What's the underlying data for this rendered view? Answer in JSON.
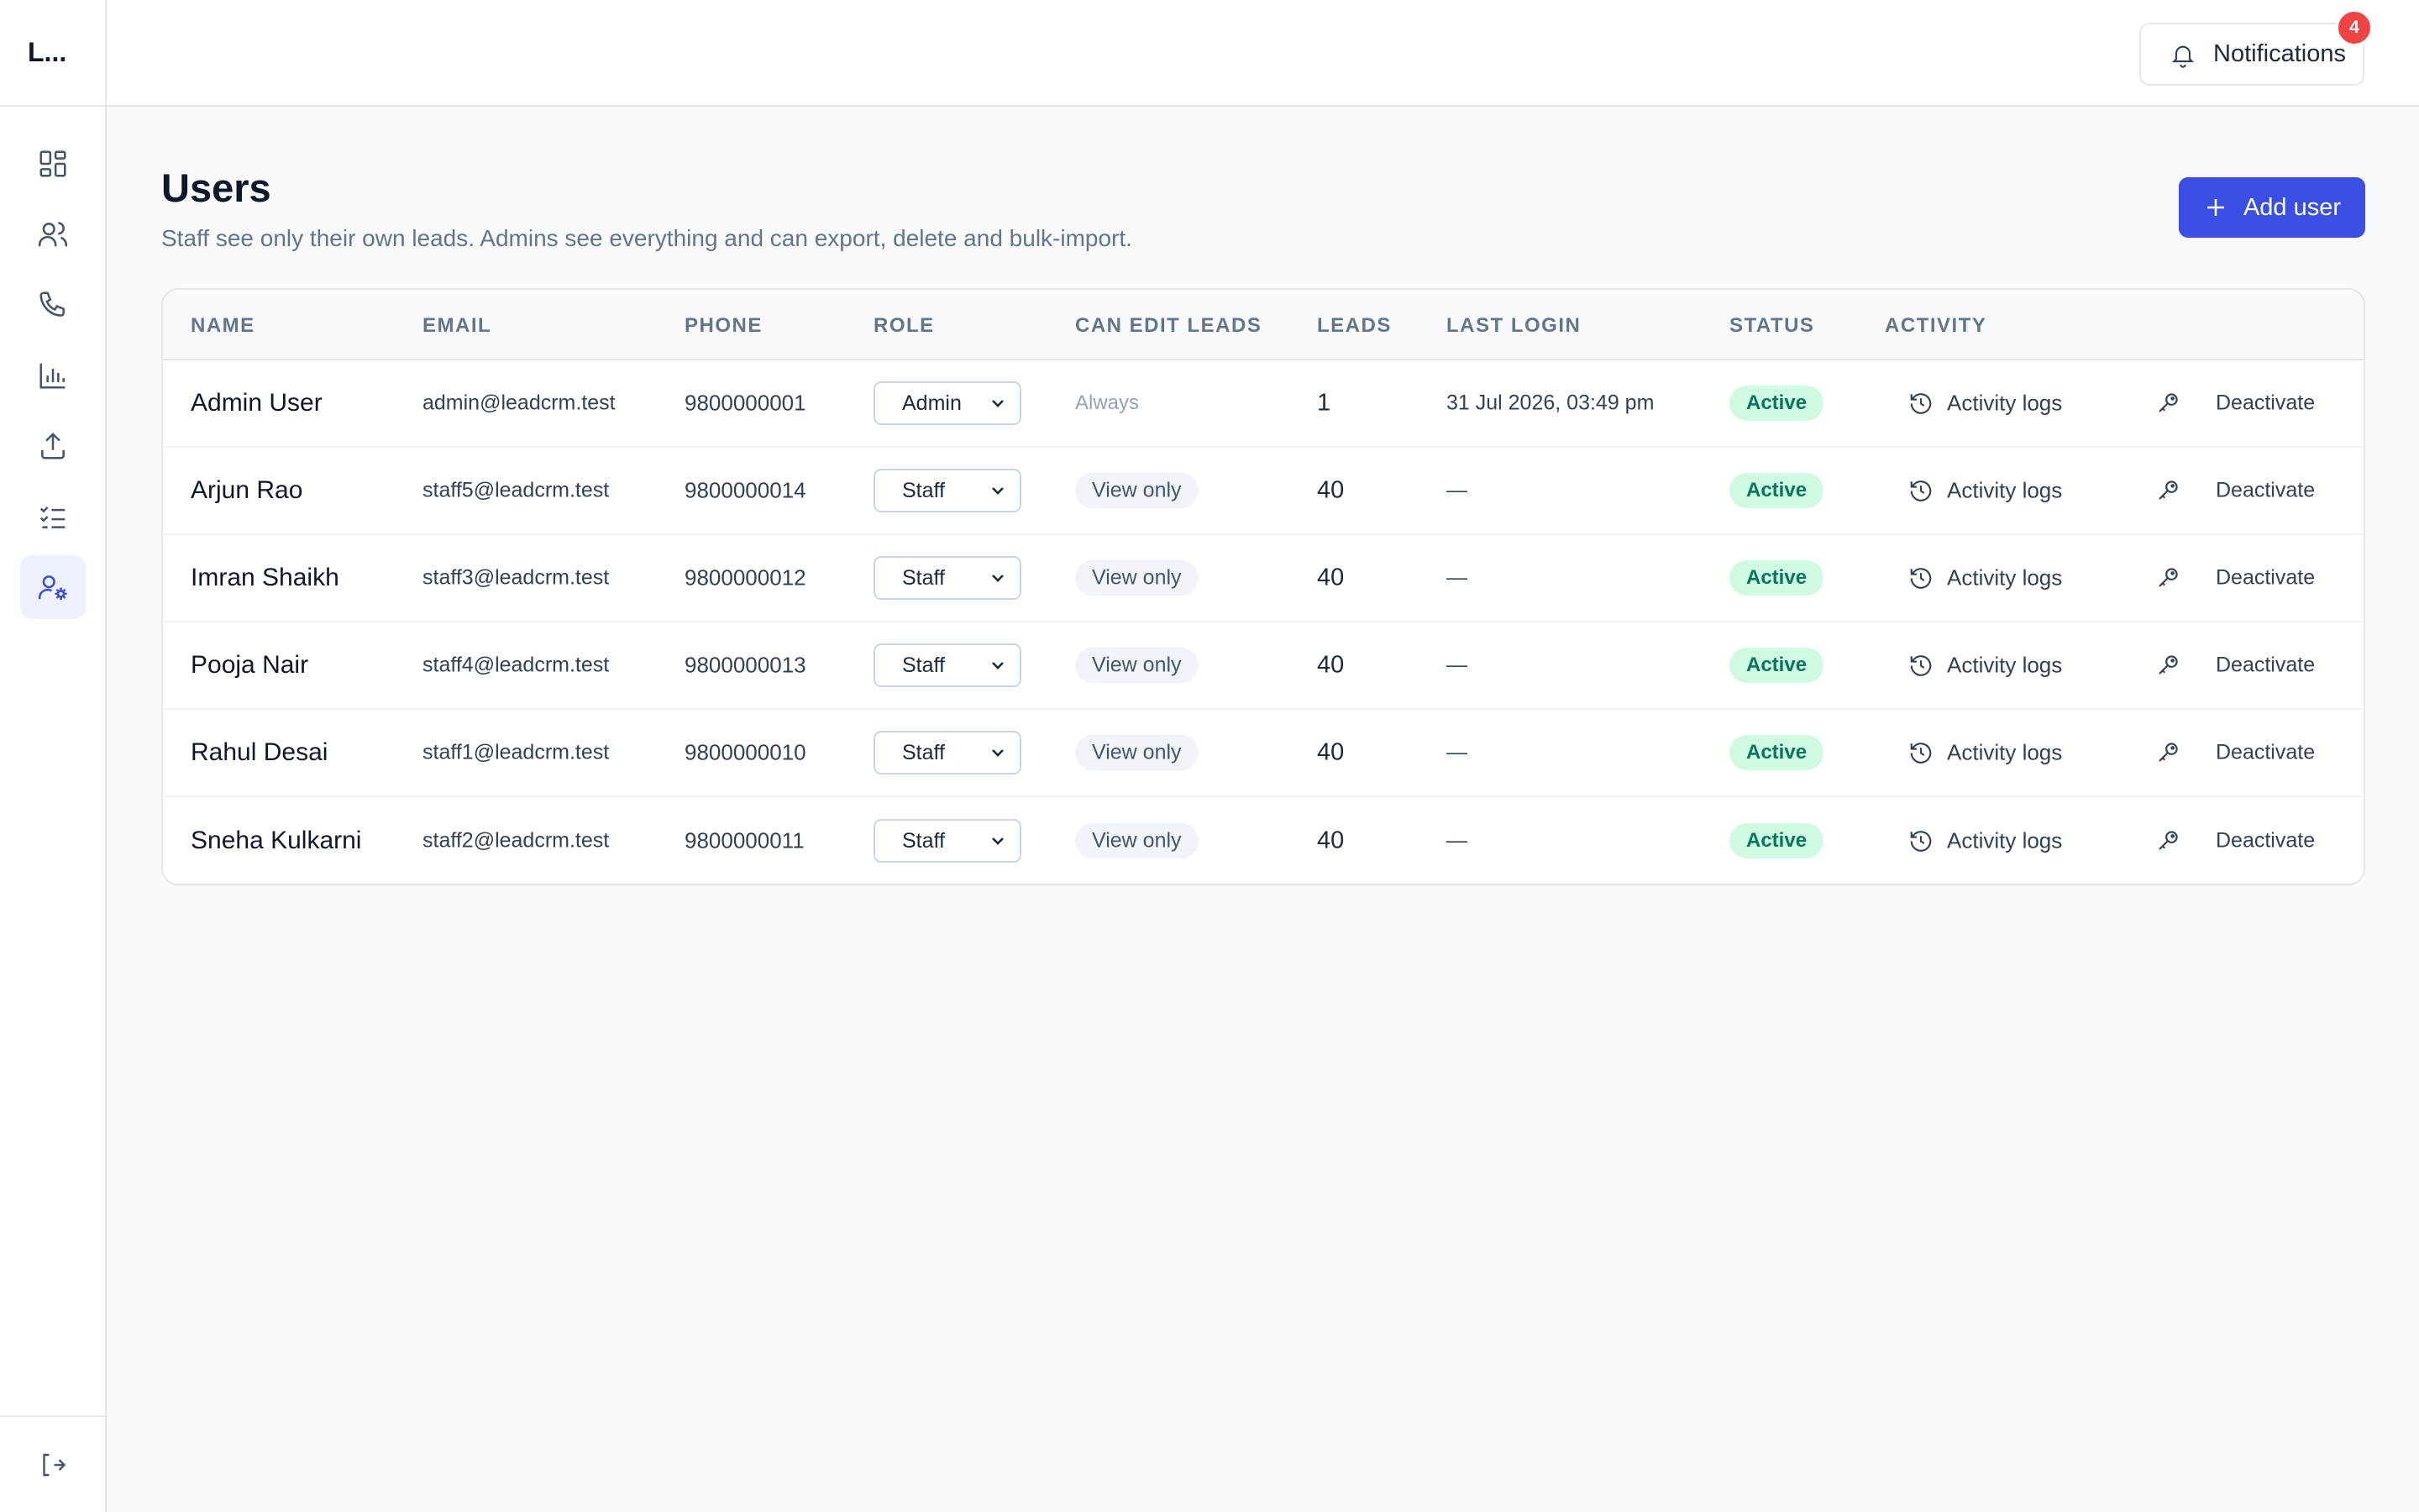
{
  "app": {
    "brand": "L..."
  },
  "sidebar": {
    "items": [
      {
        "icon": "dashboard-icon",
        "active": false
      },
      {
        "icon": "users-icon",
        "active": false
      },
      {
        "icon": "phone-icon",
        "active": false
      },
      {
        "icon": "bar-chart-icon",
        "active": false
      },
      {
        "icon": "upload-icon",
        "active": false
      },
      {
        "icon": "checklist-icon",
        "active": false
      },
      {
        "icon": "user-settings-icon",
        "active": true
      }
    ],
    "logout_icon": "logout-icon"
  },
  "topbar": {
    "notifications_label": "Notifications",
    "notifications_count": "4"
  },
  "header": {
    "title": "Users",
    "subtitle": "Staff see only their own leads. Admins see everything and can export, delete and bulk-import.",
    "add_user_label": "Add user"
  },
  "table": {
    "columns": {
      "name": "NAME",
      "email": "EMAIL",
      "phone": "PHONE",
      "role": "ROLE",
      "can_edit": "CAN EDIT LEADS",
      "leads": "LEADS",
      "last_login": "LAST LOGIN",
      "status": "STATUS",
      "activity": "ACTIVITY"
    },
    "rows": [
      {
        "name": "Admin User",
        "email": "admin@leadcrm.test",
        "phone": "9800000001",
        "role": "Admin",
        "can_edit": "Always",
        "leads": "1",
        "last_login": "31 Jul 2026, 03:49 pm",
        "status": "Active",
        "activity": "Activity logs",
        "action": "Deactivate"
      },
      {
        "name": "Arjun Rao",
        "email": "staff5@leadcrm.test",
        "phone": "9800000014",
        "role": "Staff",
        "can_edit": "View only",
        "leads": "40",
        "last_login": "—",
        "status": "Active",
        "activity": "Activity logs",
        "action": "Deactivate"
      },
      {
        "name": "Imran Shaikh",
        "email": "staff3@leadcrm.test",
        "phone": "9800000012",
        "role": "Staff",
        "can_edit": "View only",
        "leads": "40",
        "last_login": "—",
        "status": "Active",
        "activity": "Activity logs",
        "action": "Deactivate"
      },
      {
        "name": "Pooja Nair",
        "email": "staff4@leadcrm.test",
        "phone": "9800000013",
        "role": "Staff",
        "can_edit": "View only",
        "leads": "40",
        "last_login": "—",
        "status": "Active",
        "activity": "Activity logs",
        "action": "Deactivate"
      },
      {
        "name": "Rahul Desai",
        "email": "staff1@leadcrm.test",
        "phone": "9800000010",
        "role": "Staff",
        "can_edit": "View only",
        "leads": "40",
        "last_login": "—",
        "status": "Active",
        "activity": "Activity logs",
        "action": "Deactivate"
      },
      {
        "name": "Sneha Kulkarni",
        "email": "staff2@leadcrm.test",
        "phone": "9800000011",
        "role": "Staff",
        "can_edit": "View only",
        "leads": "40",
        "last_login": "—",
        "status": "Active",
        "activity": "Activity logs",
        "action": "Deactivate"
      }
    ]
  },
  "colors": {
    "accent": "#3b4fe4",
    "active_bg": "#d1fae5",
    "active_text": "#047857",
    "badge": "#ef4444"
  }
}
